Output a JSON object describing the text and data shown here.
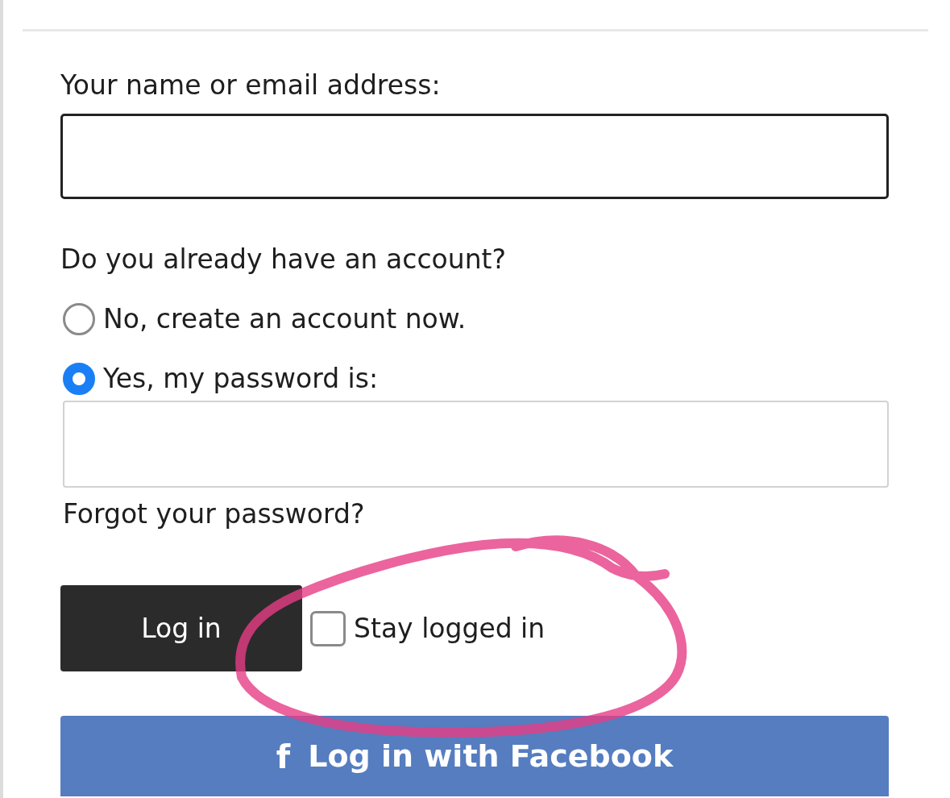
{
  "login_form": {
    "username_label": "Your name or email address:",
    "account_question": "Do you already have an account?",
    "account_options": [
      {
        "label": "No, create an account now.",
        "selected": false
      },
      {
        "label": "Yes, my password is:",
        "selected": true
      }
    ],
    "forgot_link": "Forgot your password?",
    "login_button": "Log in",
    "stay_logged_in": {
      "label": "Stay logged in",
      "checked": false
    },
    "facebook_button": {
      "icon": "f",
      "label": "Log in with Facebook"
    }
  },
  "annotation": {
    "kind": "circle"
  }
}
